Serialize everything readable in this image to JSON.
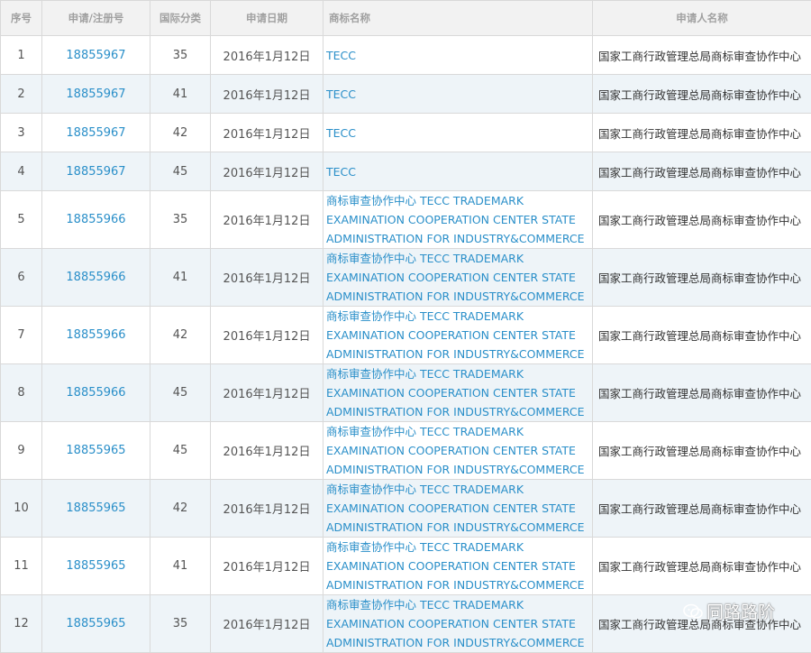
{
  "headers": {
    "index": "序号",
    "app_no": "申请/注册号",
    "class": "国际分类",
    "date": "申请日期",
    "mark_name": "商标名称",
    "applicant": "申请人名称"
  },
  "rows": [
    {
      "index": "1",
      "app_no": "18855967",
      "class": "35",
      "date": "2016年1月12日",
      "mark": [
        "TECC"
      ],
      "applicant": "国家工商行政管理总局商标审查协作中心"
    },
    {
      "index": "2",
      "app_no": "18855967",
      "class": "41",
      "date": "2016年1月12日",
      "mark": [
        "TECC"
      ],
      "applicant": "国家工商行政管理总局商标审查协作中心"
    },
    {
      "index": "3",
      "app_no": "18855967",
      "class": "42",
      "date": "2016年1月12日",
      "mark": [
        "TECC"
      ],
      "applicant": "国家工商行政管理总局商标审查协作中心"
    },
    {
      "index": "4",
      "app_no": "18855967",
      "class": "45",
      "date": "2016年1月12日",
      "mark": [
        "TECC"
      ],
      "applicant": "国家工商行政管理总局商标审查协作中心"
    },
    {
      "index": "5",
      "app_no": "18855966",
      "class": "35",
      "date": "2016年1月12日",
      "mark": [
        "商标审查协作中心 TECC TRADEMARK",
        "EXAMINATION COOPERATION CENTER STATE",
        "ADMINISTRATION FOR INDUSTRY&COMMERCE"
      ],
      "applicant": "国家工商行政管理总局商标审查协作中心"
    },
    {
      "index": "6",
      "app_no": "18855966",
      "class": "41",
      "date": "2016年1月12日",
      "mark": [
        "商标审查协作中心 TECC TRADEMARK",
        "EXAMINATION COOPERATION CENTER STATE",
        "ADMINISTRATION FOR INDUSTRY&COMMERCE"
      ],
      "applicant": "国家工商行政管理总局商标审查协作中心"
    },
    {
      "index": "7",
      "app_no": "18855966",
      "class": "42",
      "date": "2016年1月12日",
      "mark": [
        "商标审查协作中心 TECC TRADEMARK",
        "EXAMINATION COOPERATION CENTER STATE",
        "ADMINISTRATION FOR INDUSTRY&COMMERCE"
      ],
      "applicant": "国家工商行政管理总局商标审查协作中心"
    },
    {
      "index": "8",
      "app_no": "18855966",
      "class": "45",
      "date": "2016年1月12日",
      "mark": [
        "商标审查协作中心 TECC TRADEMARK",
        "EXAMINATION COOPERATION CENTER STATE",
        "ADMINISTRATION FOR INDUSTRY&COMMERCE"
      ],
      "applicant": "国家工商行政管理总局商标审查协作中心"
    },
    {
      "index": "9",
      "app_no": "18855965",
      "class": "45",
      "date": "2016年1月12日",
      "mark": [
        "商标审查协作中心 TECC TRADEMARK",
        "EXAMINATION COOPERATION CENTER STATE",
        "ADMINISTRATION FOR INDUSTRY&COMMERCE"
      ],
      "applicant": "国家工商行政管理总局商标审查协作中心"
    },
    {
      "index": "10",
      "app_no": "18855965",
      "class": "42",
      "date": "2016年1月12日",
      "mark": [
        "商标审查协作中心 TECC TRADEMARK",
        "EXAMINATION COOPERATION CENTER STATE",
        "ADMINISTRATION FOR INDUSTRY&COMMERCE"
      ],
      "applicant": "国家工商行政管理总局商标审查协作中心"
    },
    {
      "index": "11",
      "app_no": "18855965",
      "class": "41",
      "date": "2016年1月12日",
      "mark": [
        "商标审查协作中心 TECC TRADEMARK",
        "EXAMINATION COOPERATION CENTER STATE",
        "ADMINISTRATION FOR INDUSTRY&COMMERCE"
      ],
      "applicant": "国家工商行政管理总局商标审查协作中心"
    },
    {
      "index": "12",
      "app_no": "18855965",
      "class": "35",
      "date": "2016年1月12日",
      "mark": [
        "商标审查协作中心 TECC TRADEMARK",
        "EXAMINATION COOPERATION CENTER STATE",
        "ADMINISTRATION FOR INDUSTRY&COMMERCE"
      ],
      "applicant": "国家工商行政管理总局商标审查协作中心"
    }
  ],
  "watermark": {
    "text": "同路路阶",
    "icon": "wechat-icon"
  },
  "colors": {
    "link": "#2a8fc9",
    "header_bg": "#f2f2f2",
    "alt_row_bg": "#eef4f8",
    "border": "#d9d9d9"
  }
}
